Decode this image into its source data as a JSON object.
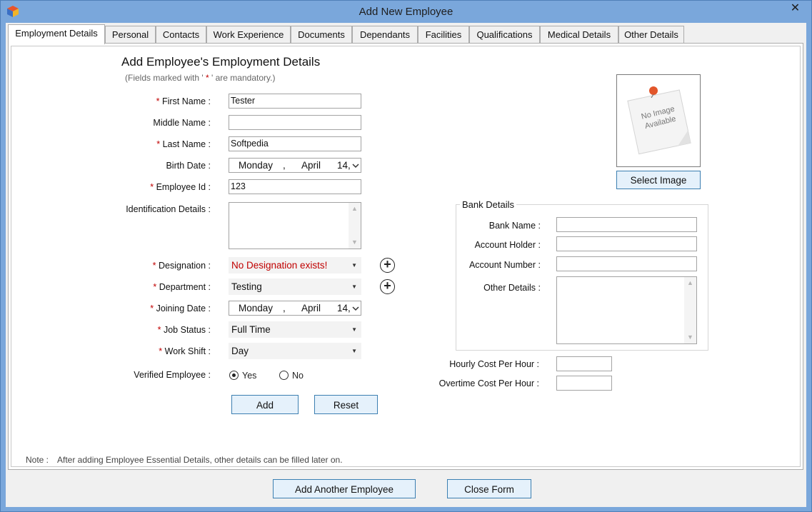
{
  "window": {
    "title": "Add New Employee",
    "close_glyph": "✕"
  },
  "tabs": [
    {
      "label": "Employment Details"
    },
    {
      "label": "Personal"
    },
    {
      "label": "Contacts"
    },
    {
      "label": "Work Experience"
    },
    {
      "label": "Documents"
    },
    {
      "label": "Dependants"
    },
    {
      "label": "Facilities"
    },
    {
      "label": "Qualifications"
    },
    {
      "label": "Medical Details"
    },
    {
      "label": "Other Details"
    }
  ],
  "form": {
    "heading": "Add Employee's Employment Details",
    "mandatory_prefix": "(Fields marked with '",
    "mandatory_star": " * ",
    "mandatory_suffix": "' are mandatory.)",
    "star": "*",
    "first_name": {
      "label": "First Name :",
      "value": "Tester"
    },
    "middle_name": {
      "label": "Middle Name :",
      "value": ""
    },
    "last_name": {
      "label": "Last Name :",
      "value": "Softpedia"
    },
    "birth_date": {
      "label": "Birth Date :",
      "day_name": "Monday",
      "sep": ",",
      "month": "April",
      "day": "14,"
    },
    "employee_id": {
      "label": "Employee Id :",
      "value": "123"
    },
    "identification": {
      "label": "Identification Details :",
      "value": ""
    },
    "designation": {
      "label": "Designation :",
      "value": "No Designation exists!"
    },
    "department": {
      "label": "Department :",
      "value": "Testing"
    },
    "joining_date": {
      "label": "Joining Date :",
      "day_name": "Monday",
      "sep": ",",
      "month": "April",
      "day": "14,"
    },
    "job_status": {
      "label": "Job Status :",
      "value": "Full Time"
    },
    "work_shift": {
      "label": "Work Shift :",
      "value": "Day"
    },
    "verified": {
      "label": "Verified Employee :",
      "yes": "Yes",
      "no": "No",
      "selected": "Yes"
    },
    "add_button": "Add",
    "reset_button": "Reset",
    "note_label": "Note :",
    "note_text": "After adding Employee Essential Details, other details can be filled later on."
  },
  "image": {
    "placeholder_line1": "No Image",
    "placeholder_line2": "Available",
    "select_button": "Select Image"
  },
  "bank": {
    "title": "Bank Details",
    "bank_name": {
      "label": "Bank Name :",
      "value": ""
    },
    "account_holder": {
      "label": "Account Holder :",
      "value": ""
    },
    "account_number": {
      "label": "Account Number  :",
      "value": ""
    },
    "other_details": {
      "label": "Other Details :",
      "value": ""
    }
  },
  "costs": {
    "hourly": {
      "label": "Hourly Cost Per Hour :",
      "value": ""
    },
    "overtime": {
      "label": "Overtime Cost Per Hour :",
      "value": ""
    }
  },
  "footer": {
    "add_another": "Add Another Employee",
    "close_form": "Close Form"
  },
  "colors": {
    "accent": "#7aa7db",
    "mandatory": "#c00000",
    "error_text": "#c00000",
    "button_bg": "#e5f1fb"
  },
  "icons": {
    "app": "cube-icon",
    "close": "close-icon",
    "plus": "plus-circle-icon",
    "dropdown": "chevron-down-icon",
    "pin": "pushpin-icon"
  }
}
